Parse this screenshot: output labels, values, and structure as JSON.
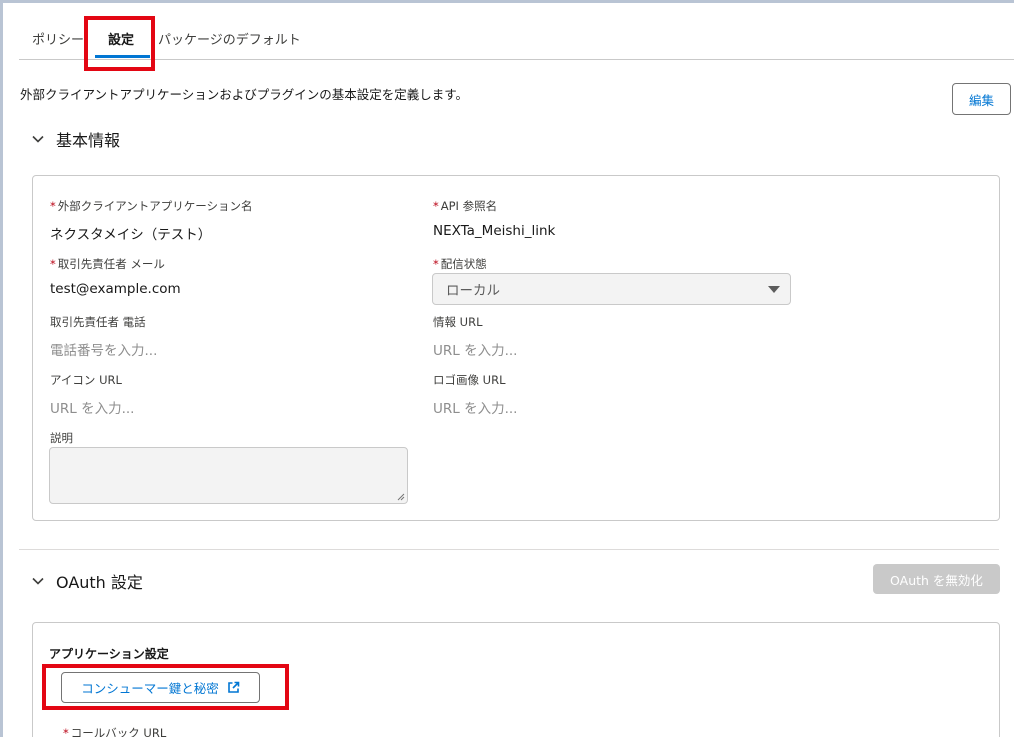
{
  "tabs": [
    {
      "label": "ポリシー"
    },
    {
      "label": "設定"
    },
    {
      "label": "パッケージのデフォルト"
    }
  ],
  "description": "外部クライアントアプリケーションおよびプラグインの基本設定を定義します。",
  "edit_label": "編集",
  "basic": {
    "title": "基本情報",
    "fields": {
      "app_name": {
        "label": "外部クライアントアプリケーション名",
        "value": "ネクスタメイシ（テスト）"
      },
      "api_name": {
        "label": "API 参照名",
        "value": "NEXTa_Meishi_link"
      },
      "contact_email": {
        "label": "取引先責任者 メール",
        "value": "test@example.com"
      },
      "distribution": {
        "label": "配信状態",
        "value": "ローカル"
      },
      "contact_phone": {
        "label": "取引先責任者 電話",
        "placeholder": "電話番号を入力..."
      },
      "info_url": {
        "label": "情報 URL",
        "placeholder": "URL を入力..."
      },
      "icon_url": {
        "label": "アイコン URL",
        "placeholder": "URL を入力..."
      },
      "logo_url": {
        "label": "ロゴ画像 URL",
        "placeholder": "URL を入力..."
      },
      "description": {
        "label": "説明"
      }
    },
    "required_mark": "*"
  },
  "oauth": {
    "title": "OAuth 設定",
    "disable_label": "OAuth を無効化",
    "app_settings_label": "アプリケーション設定",
    "consumer_button_label": "コンシューマー鍵と秘密",
    "callback_label": "コールバック URL"
  },
  "colors": {
    "accent": "#0176d3",
    "required": "#ba0517",
    "highlight": "#e30613"
  }
}
